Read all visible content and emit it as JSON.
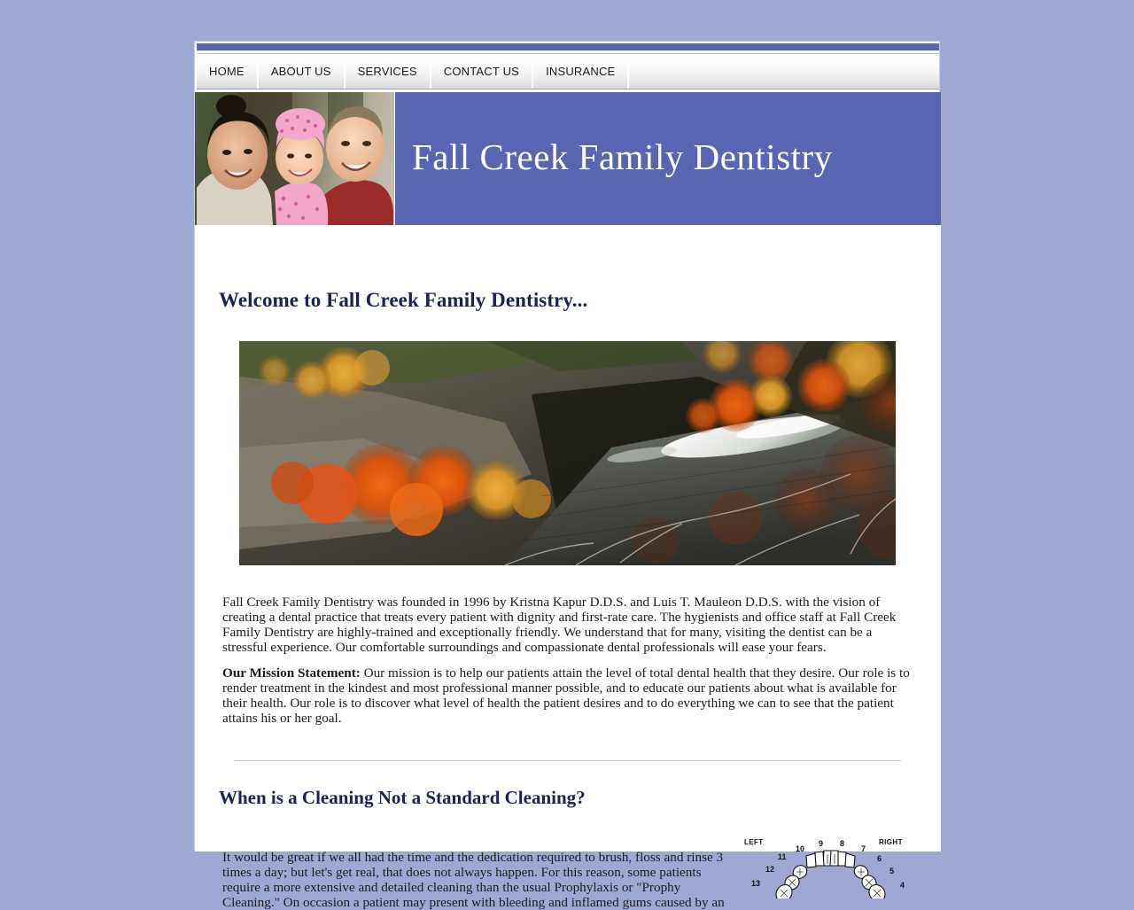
{
  "site": {
    "background_color": "#9fa8d3",
    "header_band_color": "#5765b2",
    "heading_color": "#1b2254"
  },
  "nav": {
    "items": [
      {
        "label": "HOME"
      },
      {
        "label": "ABOUT US"
      },
      {
        "label": "SERVICES"
      },
      {
        "label": "CONTACT US"
      },
      {
        "label": "INSURANCE"
      }
    ]
  },
  "header": {
    "title": "Fall Creek Family Dentistry",
    "photo_alt": "family-photo"
  },
  "main": {
    "welcome_heading": "Welcome to Fall Creek Family Dentistry...",
    "hero_image_alt": "fall-creek-gorge-autumn-photo",
    "intro_paragraph": "Fall Creek Family Dentistry was founded in 1996 by Kristna Kapur D.D.S. and Luis T. Mauleon D.D.S. with the vision of creating a dental practice that treats every patient with dignity and first-rate care. The hygienists and office staff at Fall Creek Family Dentistry are highly-trained and exceptionally friendly. We understand that for many, visiting the dentist can be a stressful experience. Our comfortable surroundings and compassionate dental professionals will ease your fears.",
    "mission_label": "Our Mission Statement:",
    "mission_text": " Our mission is to help our patients attain the level of total dental health that they desire.  Our role is to render treatment in the kindest and most professional manner possible, and to educate our patients about what is available for their health.  Our role is to discover what level of health the patient desires and to do everything we can to see that the patient attains his or her goal.",
    "cleaning_heading": "When is a Cleaning Not a Standard Cleaning?",
    "cleaning_paragraph": "It would be great if we all had the time and the dedication required to brush, floss and rinse 3 times a day; but let's get real, that does not always happen.  For this reason, some patients require a more extensive and detailed cleaning than the usual Prophylaxis or \"Prophy Cleaning.\"  On occasion a patient may present with bleeding and inflamed gums caused by an"
  },
  "tooth_chart": {
    "left_label": "LEFT",
    "right_label": "RIGHT",
    "numbers_left": [
      "13",
      "12",
      "11",
      "10",
      "9"
    ],
    "numbers_right": [
      "8",
      "7",
      "6",
      "5",
      "4"
    ]
  }
}
